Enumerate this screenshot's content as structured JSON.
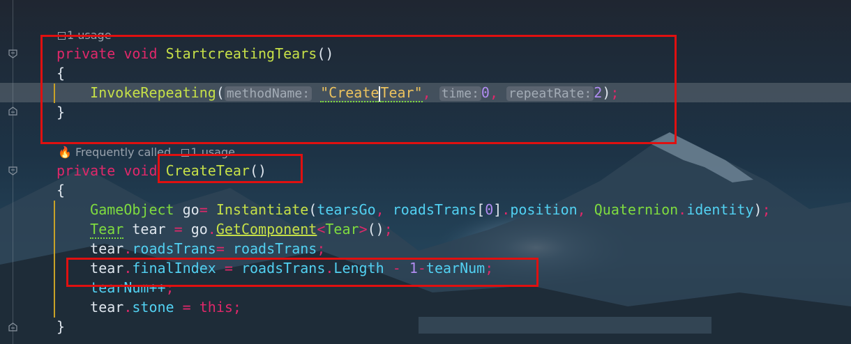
{
  "annotations": {
    "usage_1": "1 usage",
    "frequently_called": "Frequently called",
    "usage_2": "1 usage"
  },
  "method1": {
    "signature": {
      "kw1": "private",
      "kw2": "void",
      "name": "StartcreatingTears",
      "parens": "()"
    },
    "open_brace": "{",
    "call": {
      "fn": "InvokeRepeating",
      "open": "(",
      "hint1": "methodName:",
      "str1a": "\"Create",
      "str1b": "Tear\"",
      "comma1": ",",
      "hint2": "time:",
      "num1": "0",
      "comma2": ",",
      "hint3": "repeatRate:",
      "num2": "2",
      "close": ")",
      "semi": ";"
    },
    "close_brace": "}"
  },
  "method2": {
    "signature": {
      "kw1": "private",
      "kw2": "void",
      "name": "CreateTear",
      "parens": "()"
    },
    "open_brace": "{",
    "line1": {
      "type": "GameObject",
      "var": "go",
      "eq": "=",
      "fn": "Instantiate",
      "open": "(",
      "arg1": "tearsGo",
      "c1": ",",
      "arg2": "roadsTrans",
      "br_open": "[",
      "idx": "0",
      "br_close": "]",
      "dot": ".",
      "prop": "position",
      "c2": ",",
      "cls2": "Quaternion",
      "dot2": ".",
      "prop2": "identity",
      "close": ")",
      "semi": ";"
    },
    "line2": {
      "type": "Tear",
      "var": "tear",
      "eq": "=",
      "obj": "go",
      "dot": ".",
      "fn": "GetComponent",
      "gen_open": "<",
      "gen": "Tear",
      "gen_close": ">",
      "call": "()",
      "semi": ";"
    },
    "line3": {
      "obj": "tear",
      "dot": ".",
      "fld": "roadsTrans",
      "eq": "=",
      "val": "roadsTrans",
      "semi": ";"
    },
    "line4": {
      "obj": "tear",
      "dot": ".",
      "fld": "finalIndex",
      "eq": "=",
      "val": "roadsTrans",
      "dot2": ".",
      "prop": "Length",
      "minus": "-",
      "num": "1",
      "minus2": "-",
      "var": "tearNum",
      "semi": ";"
    },
    "line5": {
      "text": "tearNum++",
      "semi": ";"
    },
    "line6": {
      "obj": "tear",
      "dot": ".",
      "fld": "stone",
      "eq": "=",
      "val": "this",
      "semi": ";"
    },
    "close_brace": "}"
  },
  "colors": {
    "keyword": "#e0286a",
    "method": "#c6e048",
    "type": "#7fdc3f",
    "field": "#52d1f2",
    "number": "#b08cf0",
    "string": "#ecc25e",
    "highlight_box": "#e01010"
  },
  "icons": [
    "usage-icon",
    "fire-icon",
    "fold-icon"
  ]
}
